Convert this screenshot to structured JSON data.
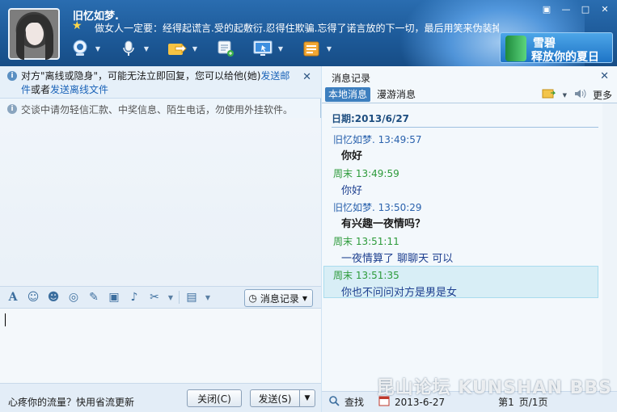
{
  "header": {
    "username": "旧忆如梦.",
    "signature": "做女人一定要：经得起谎言.受的起敷衍.忍得住欺骗.忘得了诺言放的下一切，最后用笑来伪装掉下的眼泪！！！...",
    "promo": {
      "brand": "雪碧",
      "slogan": "释放你的夏日"
    }
  },
  "left": {
    "notice": {
      "prefix": "对方\"离线或隐身\"，可能无法立即回复，您可以给他(她)",
      "link1": "发送邮件",
      "middle": "或者",
      "link2": "发送离线文件"
    },
    "security_tip": "交谈中请勿轻信汇款、中奖信息、陌生电话，勿使用外挂软件。",
    "history_button": "消息记录",
    "footer_tip": "心疼你的流量？快用省流更新",
    "close_button": "关闭(C)",
    "send_button": "发送(S)"
  },
  "right": {
    "title": "消息记录",
    "tabs": {
      "local": "本地消息",
      "roaming": "漫游消息"
    },
    "more": "更多",
    "date_label": "日期:2013/6/27",
    "messages": [
      {
        "sender": "旧忆如梦.",
        "time": "13:49:57",
        "text": "你好"
      },
      {
        "sender": "周末",
        "time": "13:49:59",
        "text": "你好"
      },
      {
        "sender": "旧忆如梦.",
        "time": "13:50:29",
        "text": "有兴趣一夜情吗？"
      },
      {
        "sender": "周末",
        "time": "13:51:11",
        "text": "一夜情算了 聊聊天 可以"
      },
      {
        "sender": "周末",
        "time": "13:51:35",
        "text": "你也不问问对方是男是女"
      }
    ],
    "footer": {
      "search": "查找",
      "date": "2013-6-27",
      "page": "第1",
      "page_total": "页/1页"
    },
    "watermark": "昆山论坛 KUNSHAN BBS"
  }
}
